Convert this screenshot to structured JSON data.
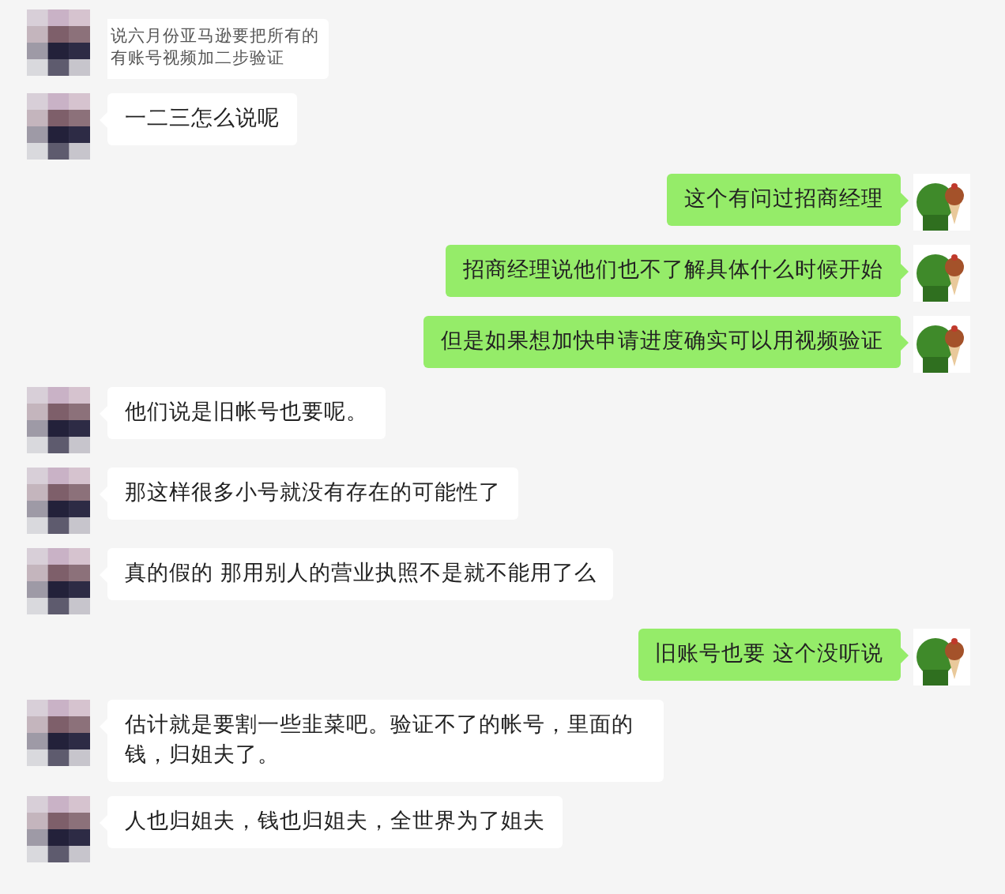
{
  "messages": [
    {
      "kind": "clipped",
      "lines": [
        "说六月份亚马逊要把所有的",
        "有账号视频加二步验证"
      ]
    },
    {
      "kind": "incoming",
      "text": "一二三怎么说呢"
    },
    {
      "kind": "outgoing",
      "text": "这个有问过招商经理"
    },
    {
      "kind": "outgoing",
      "text": "招商经理说他们也不了解具体什么时候开始"
    },
    {
      "kind": "outgoing",
      "text": "但是如果想加快申请进度确实可以用视频验证"
    },
    {
      "kind": "incoming",
      "text": "他们说是旧帐号也要呢。"
    },
    {
      "kind": "incoming",
      "text": "那这样很多小号就没有存在的可能性了"
    },
    {
      "kind": "incoming",
      "text": "真的假的 那用别人的营业执照不是就不能用了么"
    },
    {
      "kind": "outgoing",
      "text": "旧账号也要 这个没听说"
    },
    {
      "kind": "incoming",
      "text": "估计就是要割一些韭菜吧。验证不了的帐号，里面的钱，归姐夫了。"
    },
    {
      "kind": "incoming",
      "text": "人也归姐夫，钱也归姐夫，全世界为了姐夫"
    }
  ]
}
